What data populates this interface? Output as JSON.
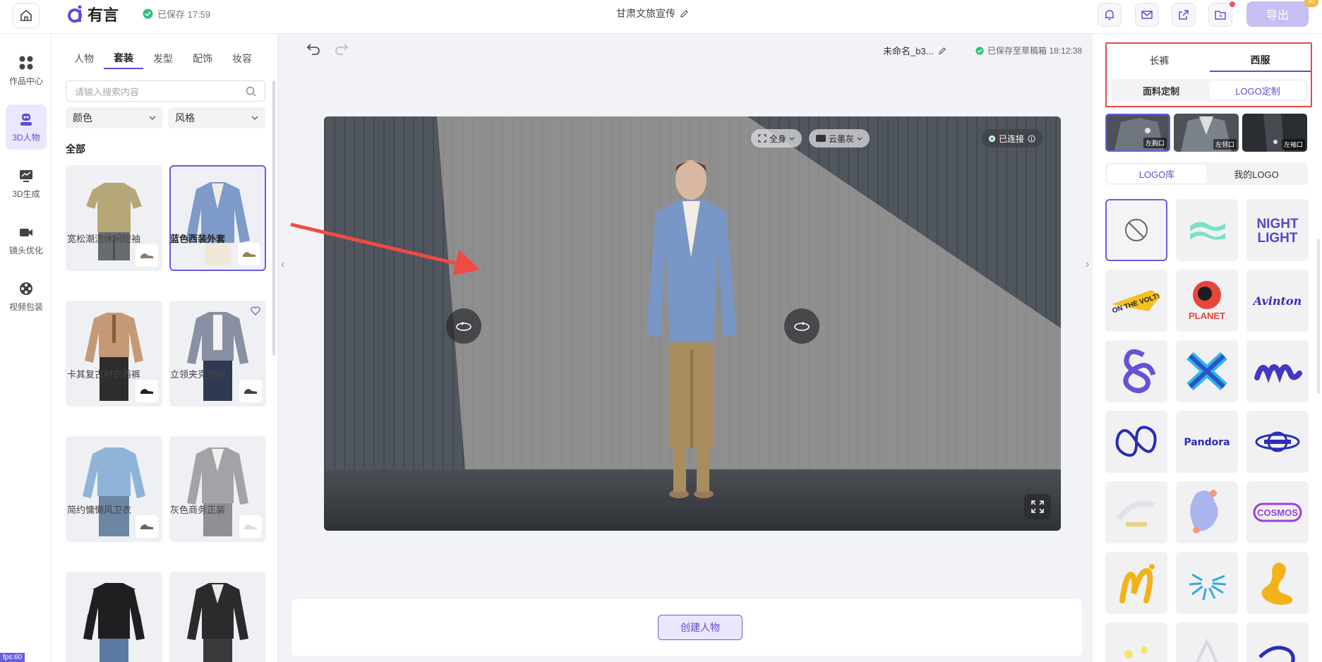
{
  "topbar": {
    "logo_text": "有言",
    "saved_status": "已保存 17:59",
    "project_title": "甘肃文旅宣传",
    "export_label": "导出",
    "ai_badge": "AI"
  },
  "leftnav": {
    "items": [
      {
        "label": "作品中心",
        "icon": "grid-icon"
      },
      {
        "label": "3D人物",
        "icon": "robot-icon"
      },
      {
        "label": "3D生成",
        "icon": "chart-icon"
      },
      {
        "label": "镜头优化",
        "icon": "camera-icon"
      },
      {
        "label": "视频包装",
        "icon": "film-reel-icon"
      }
    ],
    "fps": "fps:60"
  },
  "panel": {
    "tabs": [
      "人物",
      "套装",
      "发型",
      "配饰",
      "妆容"
    ],
    "active_tab": "套装",
    "search_placeholder": "请输入搜索内容",
    "filter_color": "颜色",
    "filter_style": "风格",
    "section_title": "全部",
    "outfits": [
      {
        "name": "宽松潮流休闲短袖"
      },
      {
        "name": "蓝色西装外套",
        "selected": true
      },
      {
        "name": "卡其复古衬衣西裤"
      },
      {
        "name": "立领夹克休闲"
      },
      {
        "name": "简约慵懒风卫衣"
      },
      {
        "name": "灰色商务正装"
      },
      {
        "name": ""
      },
      {
        "name": ""
      }
    ]
  },
  "center": {
    "file_name": "未命名_b3...",
    "draft_status": "已保存至草稿箱 18:12:38",
    "view_mode": "全身",
    "background": "云墨灰",
    "connection": "已连接",
    "create_button": "创建人物"
  },
  "right": {
    "garment_tabs": [
      "长裤",
      "西服"
    ],
    "active_garment": "西服",
    "custom_tabs": [
      "面料定制",
      "LOGO定制"
    ],
    "active_custom": "LOGO定制",
    "positions": [
      "左胸口",
      "左领口",
      "左袖口"
    ],
    "library_tabs": [
      "LOGO库",
      "我的LOGO"
    ],
    "active_library": "LOGO库",
    "logos": [
      "none-icon",
      "wave-logo",
      "night-light-logo",
      "on-the-volt-logo",
      "planet-logo",
      "avinton-logo",
      "ampersand-logo",
      "x-logo",
      "script-m-logo",
      "loop-logo",
      "pandora-logo",
      "orbit-logo",
      "faded-logo",
      "blob-logo",
      "cosmos-logo",
      "n-script-logo",
      "burst-logo",
      "swirl-logo"
    ],
    "logo_texts": {
      "night": "NIGHT",
      "light": "LIGHT",
      "volt": "ON THE VOLT!",
      "planet": "PLANET",
      "avinton": "Avinton",
      "pandora": "Pandora",
      "cosmos": "COSMOS"
    }
  },
  "colors": {
    "accent": "#6a5de0",
    "highlight_box": "#e5484d",
    "export_disabled": "#c5bff2"
  }
}
